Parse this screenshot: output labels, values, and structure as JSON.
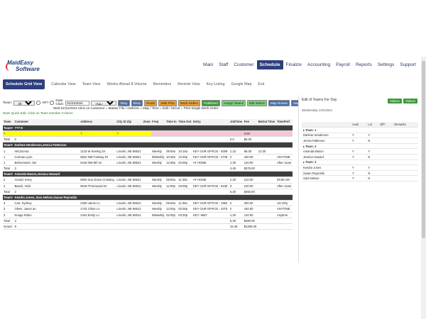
{
  "logo": {
    "line1": "MaidEasy",
    "line2": "Software"
  },
  "nav": [
    "Main",
    "Staff",
    "Customer",
    "Schedule",
    "Finalize",
    "Accounting",
    "Payroll",
    "Reports",
    "Settings",
    "Support"
  ],
  "nav_active": "Schedule",
  "subnav": {
    "button": "Schedule Grid View",
    "links": [
      "Calendar View",
      "Team View",
      "Weeks Ahead $ Volume",
      "Reminders",
      "Remote View",
      "Key Listing",
      "Google Map",
      "Exit"
    ]
  },
  "toolbar": {
    "team_label": "Team:",
    "team_select": "All",
    "ar_label": "AR?",
    "date_label": "Date Click:",
    "date_value": "01/31/2024",
    "all_select": "-ALL-",
    "buttons": [
      "3Day",
      "5Day",
      "Route",
      "2Wk Print",
      "Work Orders",
      "Published",
      "Assign Teams",
      "Edit Teams",
      "Map Routes",
      "Map"
    ]
  },
  "info_line": "Wed 01/31/2024 Click on Customer = Master File / Address = Map / Time = Edit / SeCut = Print Single Work Order.",
  "quick_line": "New! Quick Edit. Click on Team Number Column",
  "grid": {
    "headers": [
      "Team",
      "Customer",
      "Address",
      "City St Zip",
      "Zone",
      "Freq",
      "Time In",
      "Time Out",
      "Entry",
      "JobTime",
      "Fee",
      "BeOut Time",
      "TimePref"
    ],
    "rows": [
      {
        "type": "team",
        "cells": [
          "Team#",
          "???-9",
          "",
          "",
          "",
          "",
          "",
          "",
          "",
          "",
          "",
          "",
          ""
        ]
      },
      {
        "type": "yellow",
        "cells": [
          "?",
          "",
          "?",
          "?",
          "",
          "",
          "",
          "",
          "",
          "",
          "0.00",
          "",
          ""
        ]
      },
      {
        "type": "total",
        "cells": [
          "Total",
          "0",
          "",
          "",
          "",
          "",
          "",
          "",
          "",
          "0.0",
          "$0.00",
          "",
          ""
        ]
      },
      {
        "type": "team",
        "cells": [
          "Team#",
          "Darlene Henderson,Jenica Patterson",
          "",
          "",
          "",
          "",
          "",
          "",
          "",
          "",
          "",
          "",
          ""
        ]
      },
      {
        "type": "data",
        "cells": [
          "1",
          "Hirt,Donna",
          "1123 W Keeling Dr",
          "Lincoln, NE 68521",
          "",
          "Weekly",
          "09:00a",
          "10:15a",
          "KEY OUR OFFICE - 4009",
          "1.15",
          "95.00",
          "12:30",
          ""
        ]
      },
      {
        "type": "data",
        "cells": [
          "1",
          "Corman,Lynn",
          "5542 NW Fairway Dr",
          "Lincoln, NE 68521",
          "",
          "BiWeekly",
          "10:30a",
          "12:30p",
          "KEY OUR OFFICE - 4745",
          "2",
          "160.00",
          "",
          "ANYTIME"
        ]
      },
      {
        "type": "data",
        "cells": [
          "1",
          "Bohnemeier, Ste",
          "5418 NW 8th St",
          "Lincoln, NE 68521",
          "",
          "Weekly",
          "12:30p",
          "02:00p",
          "AT HOME",
          "1.30",
          "120.00",
          "",
          "After 11am"
        ]
      },
      {
        "type": "total",
        "cells": [
          "Total",
          "3",
          "",
          "",
          "",
          "",
          "",
          "",
          "",
          "4.45",
          "$375.00",
          "",
          ""
        ]
      },
      {
        "type": "team",
        "cells": [
          "Team#",
          "Amanda Mason,Jessica Howard",
          "",
          "",
          "",
          "",
          "",
          "",
          "",
          "",
          "",
          "",
          ""
        ]
      },
      {
        "type": "data",
        "cells": [
          "2",
          "Arnold, Kerry",
          "8500 Sun Down Crossing",
          "Lincoln, NE 68521",
          "",
          "Weekly",
          "09:00a",
          "11:30a",
          "AT HOME",
          "2.30",
          "210.00",
          "",
          "09:00 AM"
        ]
      },
      {
        "type": "data",
        "cells": [
          "2",
          "Baack, Vicki",
          "8018 Thornwood Dr.",
          "Lincoln, NE 68512",
          "",
          "Weekly",
          "12:00p",
          "03:00p",
          "KEY OUR OFFICE - 5440",
          "3",
          "240.00",
          "",
          "After 11am"
        ]
      },
      {
        "type": "total",
        "cells": [
          "Total",
          "2",
          "",
          "",
          "",
          "",
          "",
          "",
          "",
          "5.30",
          "$450.00",
          "",
          ""
        ]
      },
      {
        "type": "team",
        "cells": [
          "Team#",
          "Kendra Jones, Sara Nelson,Susan Reynolds",
          "",
          "",
          "",
          "",
          "",
          "",
          "",
          "",
          "",
          "",
          ""
        ]
      },
      {
        "type": "data",
        "cells": [
          "3",
          "Carr, Sydney",
          "2330 Jamie Ln",
          "Lincoln, NE 68512",
          "",
          "Weekly",
          "09:00a",
          "11:30a",
          "KEY OUR OFFICE - 1954",
          "2",
          "200.00",
          "",
          "1st Only"
        ]
      },
      {
        "type": "data",
        "cells": [
          "3",
          "Olsen, Jason an",
          "1742 Chloe Ln",
          "Lincoln, NE 68512",
          "",
          "Weekly",
          "12:00p",
          "02:00p",
          "KEY OUR OFFICE - 4375",
          "2",
          "160.00",
          "",
          "ANYTIME"
        ]
      },
      {
        "type": "data",
        "cells": [
          "3",
          "Knapp Robin",
          "2443 Emily Ln",
          "Lincoln, NE 68512",
          "",
          "BiWeekly",
          "02:00p",
          "03:30p",
          "KEY: 5667",
          "1.30",
          "120.00",
          "",
          "Anytime"
        ]
      },
      {
        "type": "total",
        "cells": [
          "Total",
          "3",
          "",
          "",
          "",
          "",
          "",
          "",
          "",
          "5.30",
          "$480.00",
          "",
          ""
        ]
      },
      {
        "type": "total",
        "cells": [
          "Grand",
          "8",
          "",
          "",
          "",
          "",
          "",
          "",
          "",
          "15.45",
          "$1305.00",
          "",
          ""
        ]
      }
    ]
  },
  "right_panel": {
    "title": "Edit of Teams For Day",
    "buttons": [
      "Video1",
      "Video2"
    ],
    "date": "Wednesday 1/31/2024",
    "headers": [
      "",
      "Avail",
      "Lst",
      "Off?",
      "Remarks"
    ],
    "rows": [
      {
        "type": "team",
        "cells": [
          "▸ Team: 1",
          "",
          "",
          "",
          ""
        ]
      },
      {
        "type": "data",
        "cells": [
          "Darlene Henderson",
          "Y",
          "Y",
          "",
          ""
        ]
      },
      {
        "type": "data",
        "cells": [
          "Jenica Patterson",
          "Y",
          "N",
          "",
          ""
        ]
      },
      {
        "type": "team",
        "cells": [
          "▸ Team: 2",
          "",
          "",
          "",
          ""
        ]
      },
      {
        "type": "data",
        "cells": [
          "Amanda Mason",
          "Y",
          "Y",
          "",
          ""
        ]
      },
      {
        "type": "data",
        "cells": [
          "Jessica Howard",
          "Y",
          "N",
          "",
          ""
        ]
      },
      {
        "type": "team",
        "cells": [
          "▸ Team: 3",
          "",
          "",
          "",
          ""
        ]
      },
      {
        "type": "data",
        "cells": [
          "Kendra Jones",
          "Y",
          "Y",
          "",
          ""
        ]
      },
      {
        "type": "data",
        "cells": [
          "Susan Reynolds",
          "Y",
          "N",
          "",
          ""
        ]
      },
      {
        "type": "data",
        "cells": [
          "Sara Nelson",
          "Y",
          "N",
          "",
          ""
        ]
      }
    ]
  }
}
